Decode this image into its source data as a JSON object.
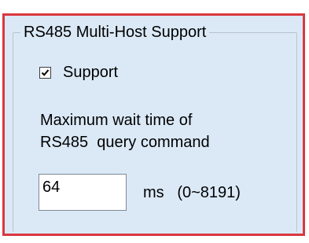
{
  "group": {
    "title": "RS485 Multi-Host Support"
  },
  "support_checkbox": {
    "label": "Support",
    "checked": true
  },
  "wait_time": {
    "description_line1": "Maximum wait time of",
    "description_line2": "RS485  query command",
    "value": "64",
    "unit_text": "ms   (0~8191)"
  },
  "colors": {
    "panel_background": "#dbe9f7",
    "highlight_border": "#d9383f"
  }
}
